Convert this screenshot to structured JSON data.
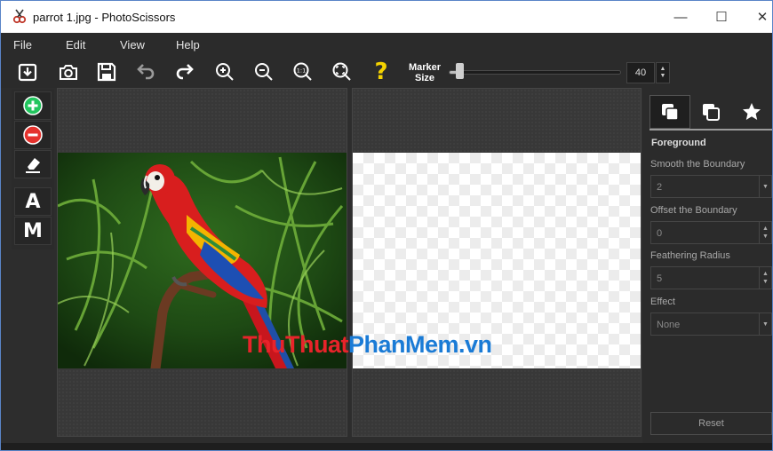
{
  "window": {
    "title": "parrot 1.jpg - PhotoScissors",
    "minimize": "—",
    "maximize": "☐",
    "close": "✕"
  },
  "menu": {
    "items": [
      "File",
      "Edit",
      "View",
      "Help"
    ]
  },
  "toolbar": {
    "icons": [
      "open-icon",
      "camera-icon",
      "save-icon",
      "undo-icon",
      "redo-icon",
      "zoom-in-icon",
      "zoom-out-icon",
      "zoom-actual-icon",
      "zoom-fit-icon",
      "help-icon"
    ],
    "help_glyph": "?",
    "zoom_actual_glyph": "1:1",
    "marker_label_line1": "Marker",
    "marker_label_line2": "Size",
    "marker_size_value": "40",
    "marker_size_fraction": 0.04,
    "spin_up": "▲",
    "spin_down": "▼"
  },
  "left_tools": {
    "auto_label": "A",
    "manual_label": "M"
  },
  "watermark": {
    "part1": "ThuThuat",
    "part2": "PhanMem.vn"
  },
  "right_panel": {
    "heading": "Foreground",
    "smooth_label": "Smooth the Boundary",
    "smooth_value": "2",
    "offset_label": "Offset the Boundary",
    "offset_value": "0",
    "feather_label": "Feathering Radius",
    "feather_value": "5",
    "effect_label": "Effect",
    "effect_value": "None",
    "reset_label": "Reset",
    "dropdown_arrow": "▼",
    "spin_up": "▲",
    "spin_down": "▼"
  },
  "colors": {
    "add_green": "#22c55e",
    "remove_red": "#e5322d",
    "help_yellow": "#f5d300"
  }
}
